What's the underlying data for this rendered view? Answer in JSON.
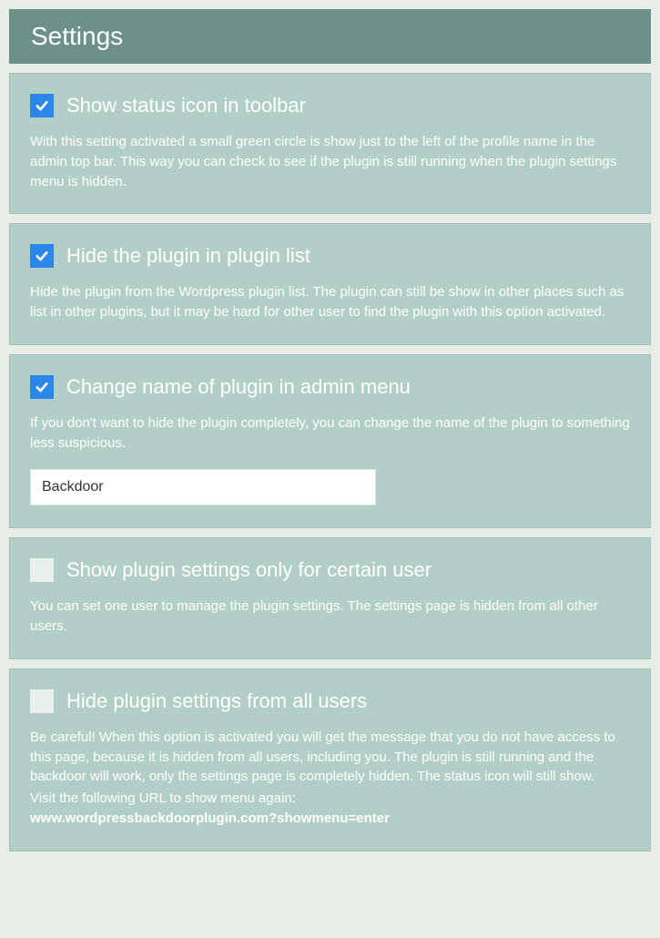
{
  "header": {
    "title": "Settings"
  },
  "options": {
    "status_icon": {
      "label": "Show status icon in toolbar",
      "description": "With this setting activated a small green circle is show just to the left of the profile name in the admin top bar. This way you can check to see if the plugin is still running when the plugin settings menu is hidden."
    },
    "hide_plugin_list": {
      "label": "Hide the plugin in plugin list",
      "description": "Hide the plugin from the Wordpress plugin list. The plugin can still be show in other places such as list in other plugins, but it may be hard for other user to find the plugin with this option activated."
    },
    "change_name": {
      "label": "Change name of plugin in admin menu",
      "description": "If you don't want to hide the plugin completely, you can change the name of the plugin to something less suspicious.",
      "input_value": "Backdoor"
    },
    "certain_user": {
      "label": "Show plugin settings only for certain user",
      "description": "You can set one user to manage the plugin settings. The settings page is hidden from all other users."
    },
    "hide_all": {
      "label": "Hide plugin settings from all users",
      "description": "Be careful! When this option is activated you will get the message that you do not have access to this page, because it is hidden from all users, including you. The plugin is still running and the backdoor will work, only the settings page is completely hidden. The status icon will still show.",
      "extra_line": "Visit the following URL to show menu again:",
      "url": "www.wordpressbackdoorplugin.com?showmenu=enter"
    }
  }
}
